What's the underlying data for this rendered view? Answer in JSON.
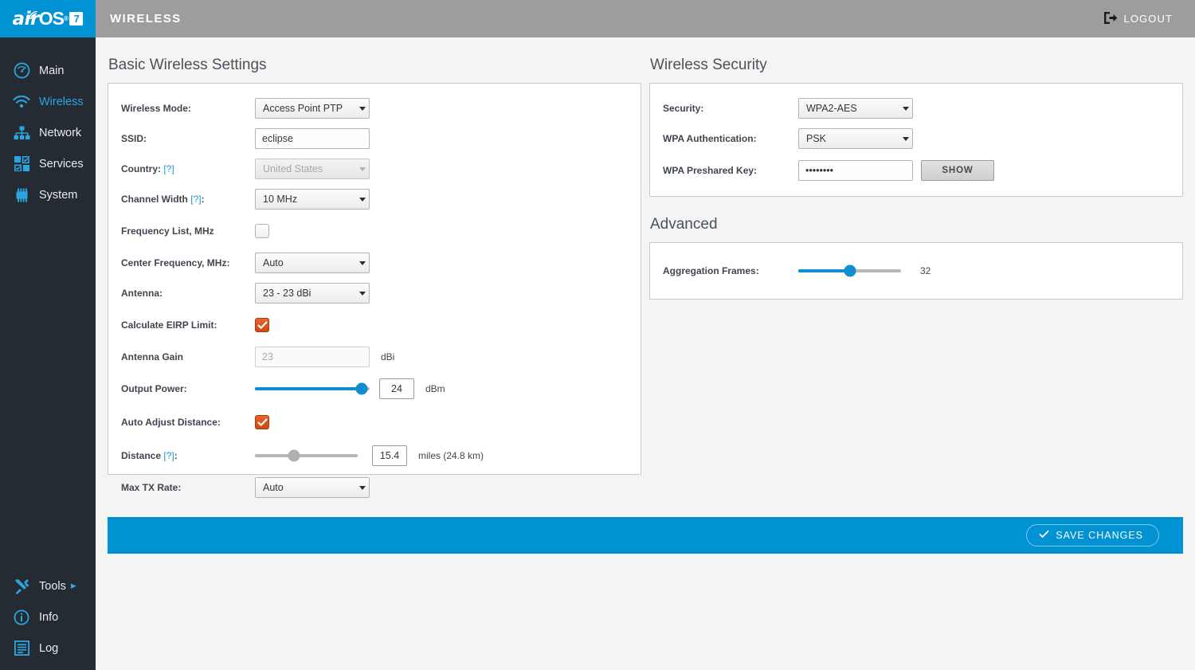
{
  "brand": {
    "logo_air": "air",
    "logo_os": "OS",
    "logo_reg": "®",
    "logo_version": "7"
  },
  "topbar": {
    "title": "WIRELESS",
    "logout_label": "LOGOUT",
    "logout_icon": "logout-icon"
  },
  "sidebar": {
    "items": [
      {
        "label": "Main",
        "icon": "gauge-icon",
        "active": false
      },
      {
        "label": "Wireless",
        "icon": "wifi-icon",
        "active": true
      },
      {
        "label": "Network",
        "icon": "network-icon",
        "active": false
      },
      {
        "label": "Services",
        "icon": "services-icon",
        "active": false
      },
      {
        "label": "System",
        "icon": "system-icon",
        "active": false
      }
    ],
    "bottom_items": [
      {
        "label": "Tools",
        "icon": "tools-icon",
        "caret": "▶"
      },
      {
        "label": "Info",
        "icon": "info-icon",
        "caret": ""
      },
      {
        "label": "Log",
        "icon": "log-icon",
        "caret": ""
      }
    ]
  },
  "basic": {
    "title": "Basic Wireless Settings",
    "wireless_mode": {
      "label": "Wireless Mode:",
      "value": "Access Point PTP"
    },
    "ssid": {
      "label": "SSID:",
      "value": "eclipse",
      "placeholder": ""
    },
    "country": {
      "label": "Country:",
      "help": "[?]",
      "value": "United States",
      "disabled": true
    },
    "channel_width": {
      "label": "Channel Width",
      "help": "[?]",
      "suffix": ":",
      "value": "10 MHz"
    },
    "frequency_list": {
      "label": "Frequency List, MHz",
      "checked": false
    },
    "center_frequency": {
      "label": "Center Frequency, MHz:",
      "value": "Auto"
    },
    "antenna": {
      "label": "Antenna:",
      "value": "23 - 23 dBi"
    },
    "calculate_eirp": {
      "label": "Calculate EIRP Limit:",
      "checked": true
    },
    "antenna_gain": {
      "label": "Antenna Gain",
      "value": "23",
      "unit": "dBi",
      "disabled": true
    },
    "output_power": {
      "label": "Output Power:",
      "value": "24",
      "unit": "dBm",
      "percent": 93
    },
    "auto_adjust_distance": {
      "label": "Auto Adjust Distance:",
      "checked": true
    },
    "distance": {
      "label": "Distance",
      "help": "[?]",
      "suffix": ":",
      "value": "15.4",
      "unit": "miles (24.8 km)",
      "percent": 38,
      "disabled": true
    },
    "max_tx_rate": {
      "label": "Max TX Rate:",
      "value": "Auto"
    }
  },
  "security": {
    "title": "Wireless Security",
    "security": {
      "label": "Security:",
      "value": "WPA2-AES"
    },
    "wpa_auth": {
      "label": "WPA Authentication:",
      "value": "PSK"
    },
    "psk": {
      "label": "WPA Preshared Key:",
      "value": "••••••••",
      "show_label": "SHOW"
    }
  },
  "advanced": {
    "title": "Advanced",
    "aggregation_frames": {
      "label": "Aggregation Frames:",
      "value": "32",
      "percent": 50
    }
  },
  "savebar": {
    "save_label": "SAVE CHANGES",
    "check_icon": "check-icon"
  },
  "colors": {
    "brand_blue": "#0092d3",
    "sidebar_bg": "#252b33",
    "topbar_grey": "#9d9d9d",
    "accent_blue": "#0d8ecf",
    "checkbox_orange": "#d84e13",
    "link_blue": "#2196d6"
  }
}
